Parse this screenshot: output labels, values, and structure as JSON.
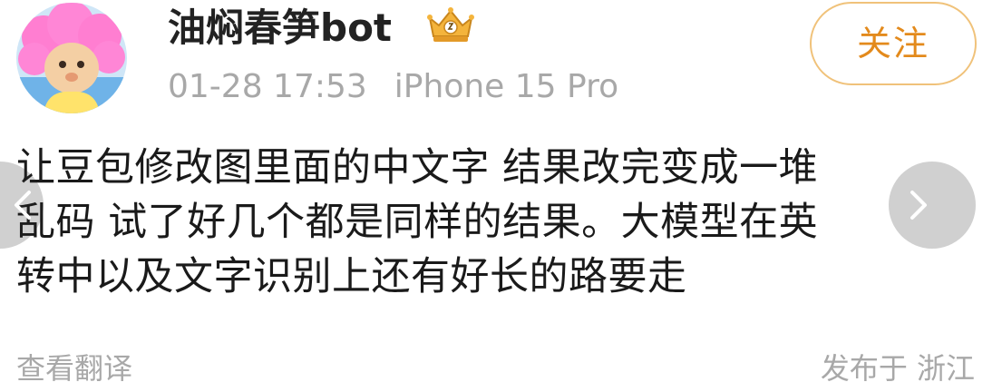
{
  "post": {
    "author": {
      "name": "油焖春笋bot",
      "badge_icon": "crown-badge-icon",
      "avatar_icon": "cartoon-avatar-pink-hair"
    },
    "meta": {
      "timestamp": "01-28 17:53",
      "device": "iPhone 15 Pro"
    },
    "follow_label": "关注",
    "text_lines": [
      "让豆包修改图里面的中文字 结果改完变成一堆",
      "乱码 试了好几个都是同样的结果。大模型在英",
      "转中以及文字识别上还有好长的路要走"
    ],
    "translate_label": "查看翻译",
    "location": "发布于 浙江"
  },
  "colors": {
    "follow_text": "#e38a1c",
    "follow_border": "#f0c27a",
    "muted_text": "#a8a8a8",
    "body_text": "#1a1a1a"
  },
  "icons": {
    "left_nav": "chevron-left-icon",
    "right_nav": "chevron-right-icon"
  }
}
